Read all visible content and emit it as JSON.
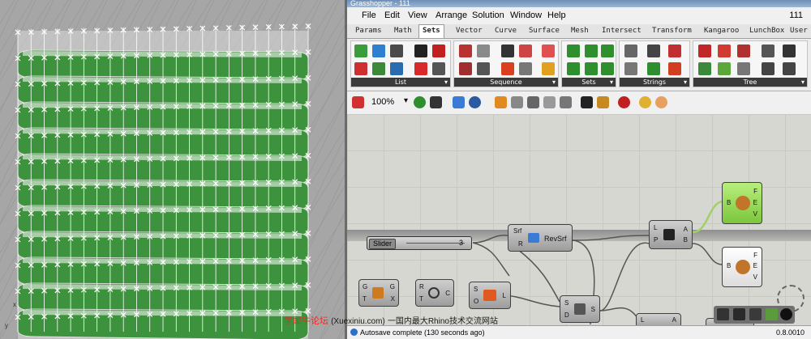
{
  "window": {
    "title": "Grasshopper - 111"
  },
  "menu": {
    "items": [
      "File",
      "Edit",
      "View",
      "Arrange",
      "Solution",
      "Window",
      "Help"
    ],
    "right_label": "111"
  },
  "tabs": {
    "items": [
      "Params",
      "Math",
      "Sets",
      "Vector",
      "Curve",
      "Surface",
      "Mesh",
      "Intersect",
      "Transform",
      "Kangaroo",
      "LunchBox",
      "User"
    ],
    "active": "Sets"
  },
  "ribbon": {
    "panels": [
      "List",
      "Sequence",
      "Sets",
      "Strings",
      "Tree"
    ]
  },
  "toolbar": {
    "zoom": "100%"
  },
  "canvas": {
    "slider": {
      "label": "Slider",
      "value": "3"
    },
    "components": {
      "revsrf": {
        "inputs": [
          "Srf",
          "R"
        ],
        "name": "RevSrf"
      },
      "split": {
        "inputs": [
          "L",
          "P"
        ],
        "outputs": [
          "A",
          "B"
        ]
      },
      "green": {
        "input": "B",
        "outputs": [
          "F",
          "E",
          "V"
        ]
      },
      "white": {
        "input": "B",
        "outputs": [
          "F",
          "E",
          "V"
        ]
      },
      "c1": {
        "inputs": [
          "G",
          "T"
        ],
        "outputs": [
          "G",
          "X"
        ]
      },
      "c2": {
        "inputs": [
          "R",
          "T"
        ],
        "output": "C"
      },
      "c3": {
        "inputs": [
          "S",
          "O"
        ],
        "output": "L"
      },
      "c4": {
        "inputs": [
          "S",
          "D"
        ],
        "output": "S"
      },
      "c5": {
        "inputs": [
          "L",
          "A"
        ]
      }
    }
  },
  "status": {
    "text": "Autosave complete (130 seconds ago)",
    "version": "0.8.0010"
  },
  "watermark": {
    "brand": "学犀牛论坛",
    "site": "(Xuexiniu.com)",
    "tagline": "一国内最大Rhino技术交流网站"
  },
  "viewport": {
    "axis_x": "x",
    "axis_y": "y"
  },
  "colors": {
    "facade_green": "#2f8f2f",
    "canvas_bg": "#d7d7d1",
    "component_green": "#8fd54a"
  }
}
